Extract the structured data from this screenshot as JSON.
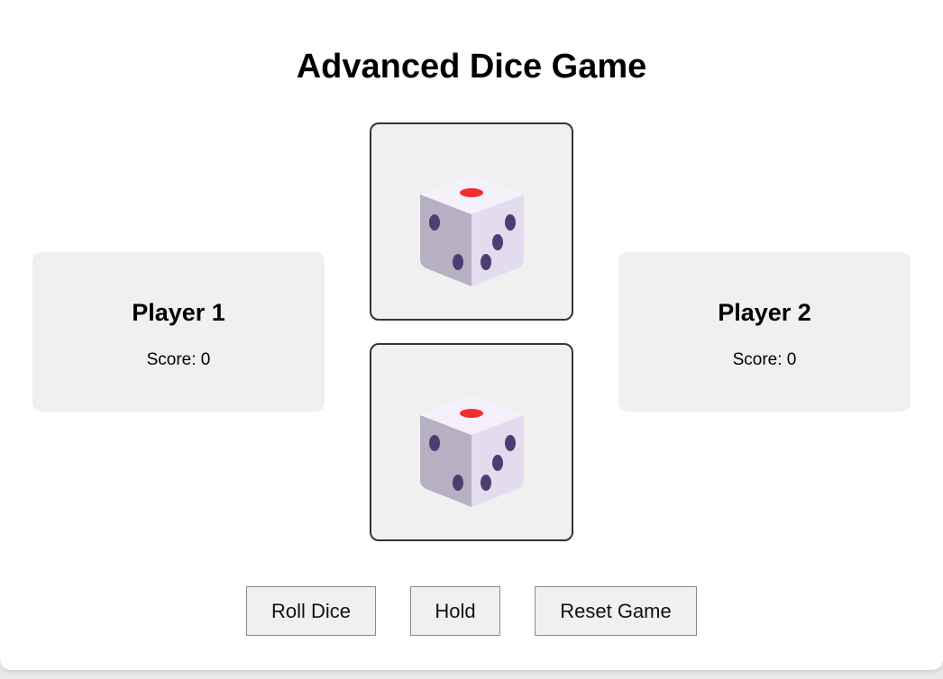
{
  "title": "Advanced Dice Game",
  "players": [
    {
      "name": "Player 1",
      "score_label": "Score: 0"
    },
    {
      "name": "Player 2",
      "score_label": "Score: 0"
    }
  ],
  "dice": [
    {
      "icon": "dice-icon"
    },
    {
      "icon": "dice-icon"
    }
  ],
  "buttons": {
    "roll": "Roll Dice",
    "hold": "Hold",
    "reset": "Reset Game"
  },
  "colors": {
    "panel": "#f0f0f0",
    "die_border": "#333333",
    "pip": "#4b3f72",
    "top_pip": "#ef2f2f"
  }
}
